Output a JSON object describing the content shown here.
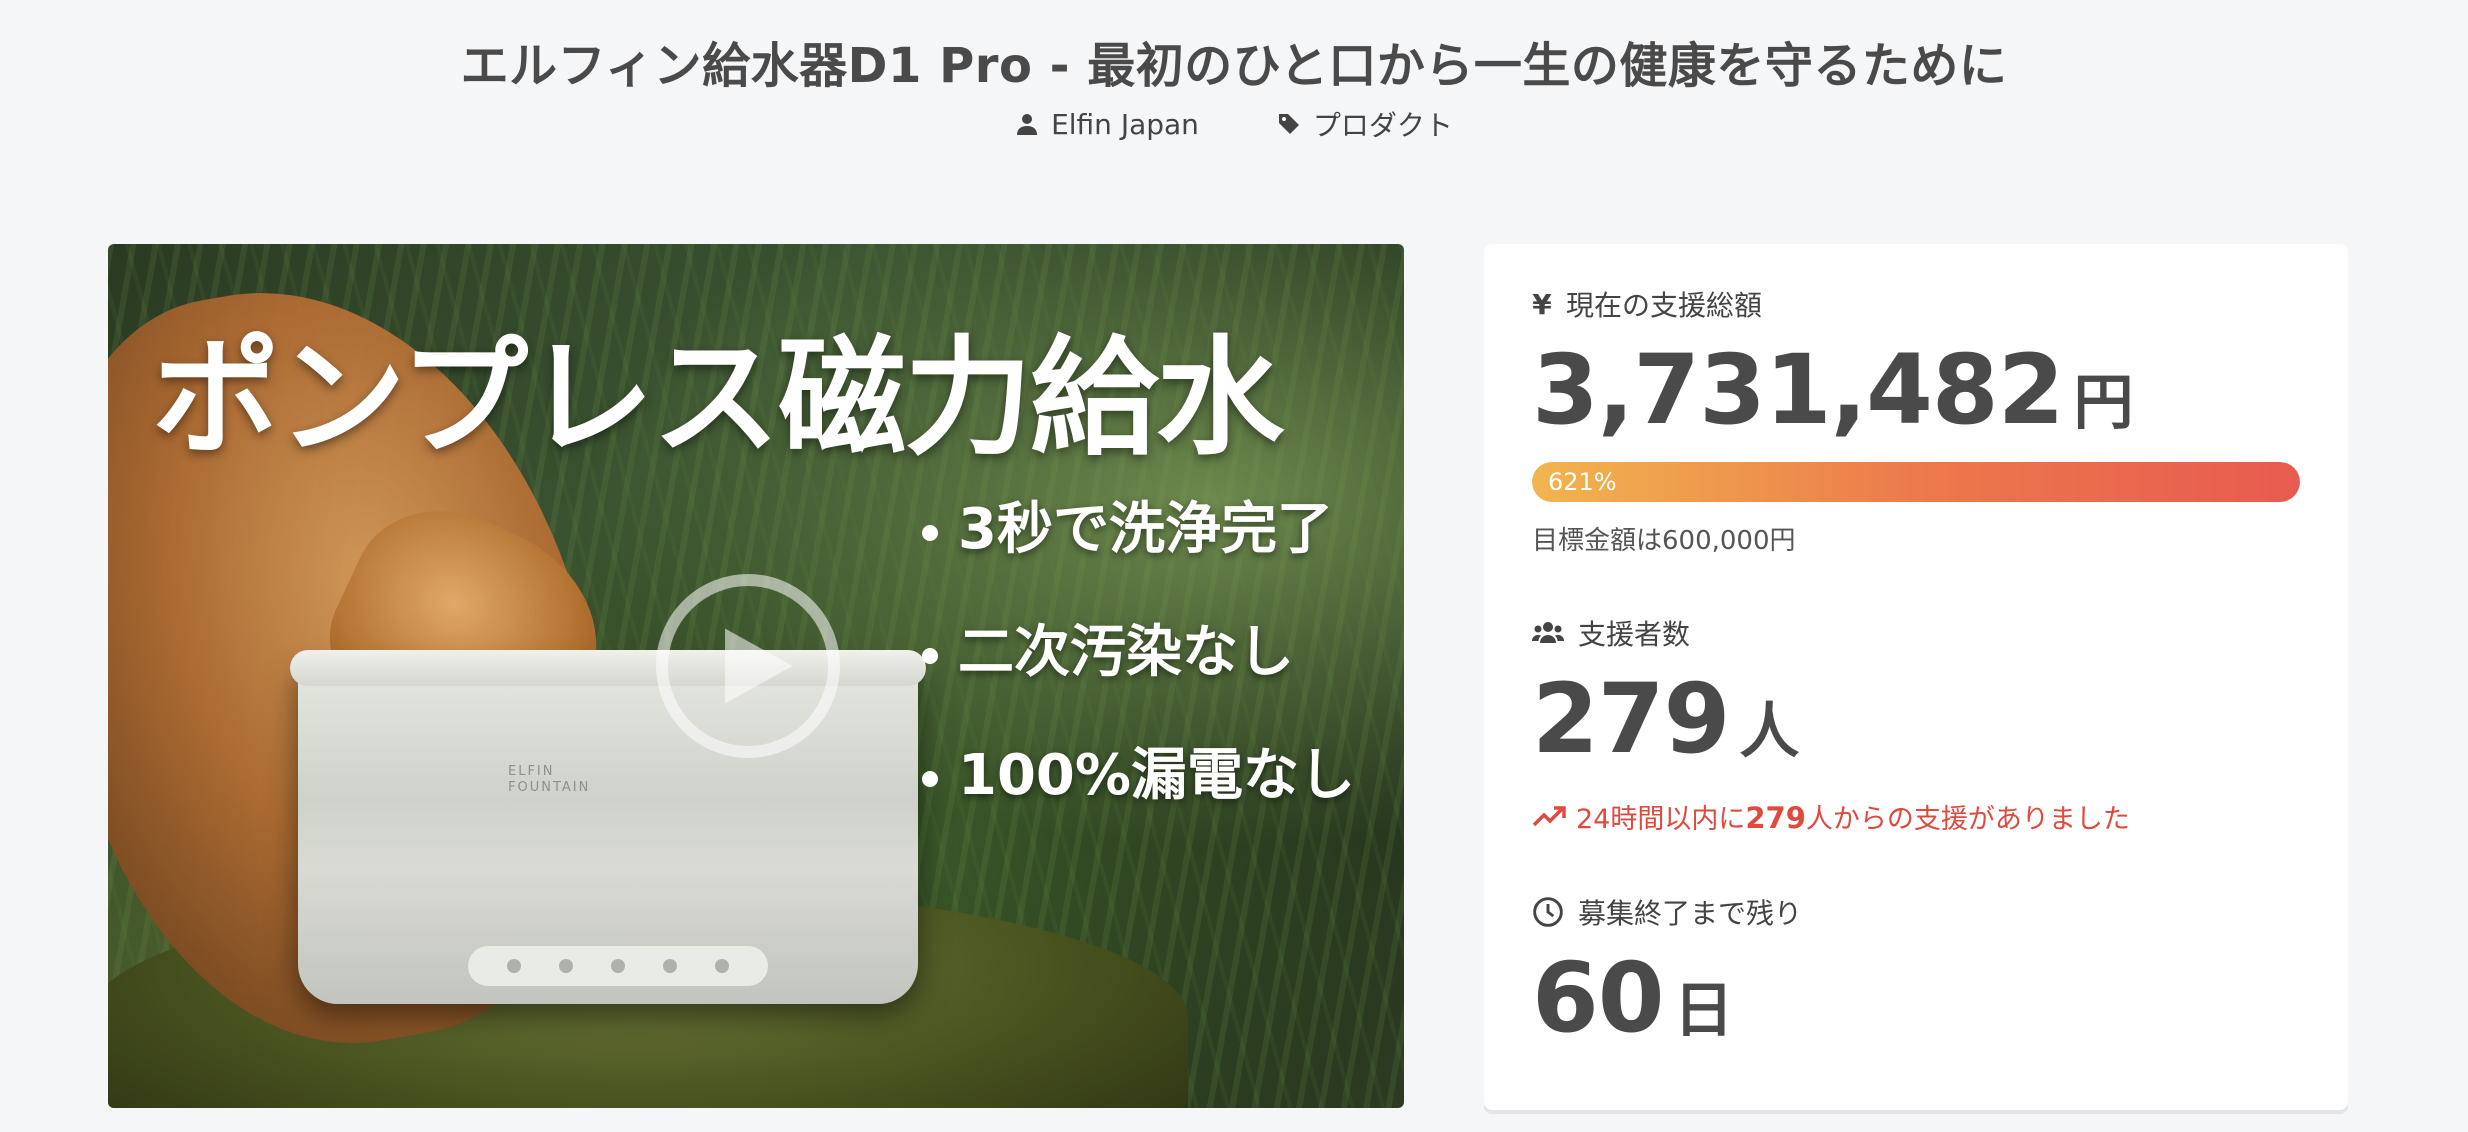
{
  "page": {
    "title": "エルフィン給水器D1 Pro - 最初のひと口から一生の健康を守るために"
  },
  "meta": {
    "author": "Elfin Japan",
    "category": "プロダクト"
  },
  "hero": {
    "headline": "ポンプレス磁力給水",
    "bullets": [
      "3秒で洗浄完了",
      "二次汚染なし",
      "100%漏電なし"
    ],
    "product_brand_line1": "ELFIN",
    "product_brand_line2": "FOUNTAIN"
  },
  "stats": {
    "funding": {
      "label": "現在の支援総額",
      "currency_symbol": "¥",
      "amount": "3,731,482",
      "unit": "円",
      "progress_label": "621%",
      "progress_fraction": 1.0,
      "goal_text": "目標金額は600,000円"
    },
    "supporters": {
      "label": "支援者数",
      "count": "279",
      "unit": "人",
      "trend_prefix": "24時間以内に",
      "trend_count": "279",
      "trend_suffix": "人からの支援がありました"
    },
    "remaining": {
      "label": "募集終了まで残り",
      "days": "60",
      "unit": "日"
    }
  },
  "colors": {
    "progress_start": "#f1b54e",
    "progress_end": "#e85a4f",
    "trend": "#e04a3e",
    "text_dark": "#4a4a4a"
  },
  "icons": {
    "author": "user-icon",
    "category": "tag-icon",
    "funding": "yen-icon",
    "supporters": "users-icon",
    "trend": "trending-up-icon",
    "remaining": "clock-icon",
    "play": "play-icon"
  }
}
